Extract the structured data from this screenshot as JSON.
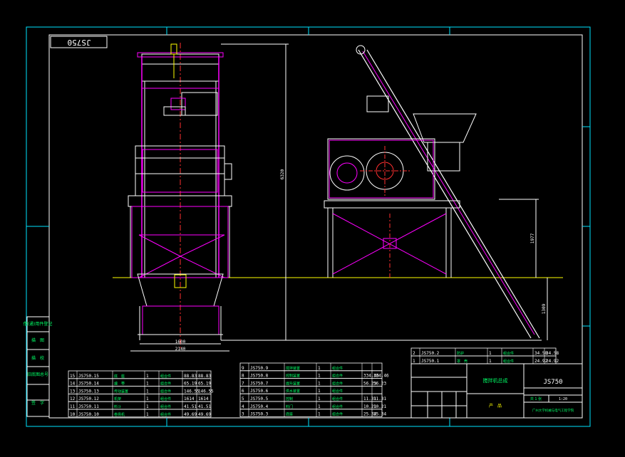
{
  "drawing": {
    "name_box": "JS750",
    "dim_height_total": "6320",
    "dim_right_upper": "1977",
    "dim_right_lower": "1309",
    "dim_width_inner": "1600",
    "dim_width_outer": "2140"
  },
  "left_labels": [
    "借(通)用件登记",
    "描　图",
    "描　校",
    "旧底图总号",
    "签　字"
  ],
  "bom_left": [
    {
      "no": "15",
      "code": "JS750.15",
      "name": "底　座",
      "qty": "1",
      "mat": "组合件",
      "w1": "88.83",
      "w2": "88.83"
    },
    {
      "no": "14",
      "code": "JS750.14",
      "name": "编　带",
      "qty": "1",
      "mat": "组合件",
      "w1": "65.19",
      "w2": "65.19"
    },
    {
      "no": "13",
      "code": "JS750.13",
      "name": "传动装置",
      "qty": "1",
      "mat": "组合件",
      "w1": "146.55",
      "w2": "146.55"
    },
    {
      "no": "12",
      "code": "JS750.12",
      "name": "机架",
      "qty": "1",
      "mat": "组合件",
      "w1": "1614",
      "w2": "1614"
    },
    {
      "no": "11",
      "code": "JS750.11",
      "name": "料斗",
      "qty": "1",
      "mat": "组合件",
      "w1": "41.51",
      "w2": "41.51"
    },
    {
      "no": "10",
      "code": "JS750.10",
      "name": "卷扬机",
      "qty": "1",
      "mat": "组合件",
      "w1": "49.69",
      "w2": "49.69"
    }
  ],
  "bom_middle": [
    {
      "no": "9",
      "code": "JS750.9",
      "name": "搅拌装置",
      "qty": "1",
      "mat": "组合件",
      "w1": "",
      "w2": ""
    },
    {
      "no": "8",
      "code": "JS750.8",
      "name": "控制装置",
      "qty": "1",
      "mat": "组合件",
      "w1": "334.46",
      "w2": "334.46"
    },
    {
      "no": "7",
      "code": "JS750.7",
      "name": "提升装置",
      "qty": "1",
      "mat": "组合件",
      "w1": "56.23",
      "w2": "56.23"
    },
    {
      "no": "6",
      "code": "JS750.6",
      "name": "供水装置",
      "qty": "1",
      "mat": "组合件",
      "w1": "",
      "w2": ""
    },
    {
      "no": "5",
      "code": "JS750.5",
      "name": "控制",
      "qty": "1",
      "mat": "组合件",
      "w1": "11.31",
      "w2": "11.31"
    },
    {
      "no": "4",
      "code": "JS750.4",
      "name": "料门",
      "qty": "1",
      "mat": "组合件",
      "w1": "10.21",
      "w2": "10.21"
    },
    {
      "no": "3",
      "code": "JS750.3",
      "name": "底座",
      "qty": "1",
      "mat": "组合件",
      "w1": "25.34",
      "w2": "25.34"
    }
  ],
  "bom_right": [
    {
      "no": "2",
      "code": "JS750.2",
      "name": "防护",
      "qty": "1",
      "mat": "组合件",
      "w1": "34.58",
      "w2": "34.58"
    },
    {
      "no": "1",
      "code": "JS750.1",
      "name": "罩　壳",
      "qty": "1",
      "mat": "组合件",
      "w1": "24.92",
      "w2": "24.92"
    }
  ],
  "title_block": {
    "main_title": "搅拌机总成",
    "drawing_no": "JS750",
    "scale": "1:20",
    "sheets": "共 1 张",
    "company": "广州大学机械与电气工程学院",
    "dept": "产　品"
  },
  "colors": {
    "frame": "#00e5ff",
    "outline": "#ffffff",
    "parts": "#ff00ff",
    "ground": "#ffff00",
    "center": "#ff3030",
    "text": "#00ff66"
  }
}
